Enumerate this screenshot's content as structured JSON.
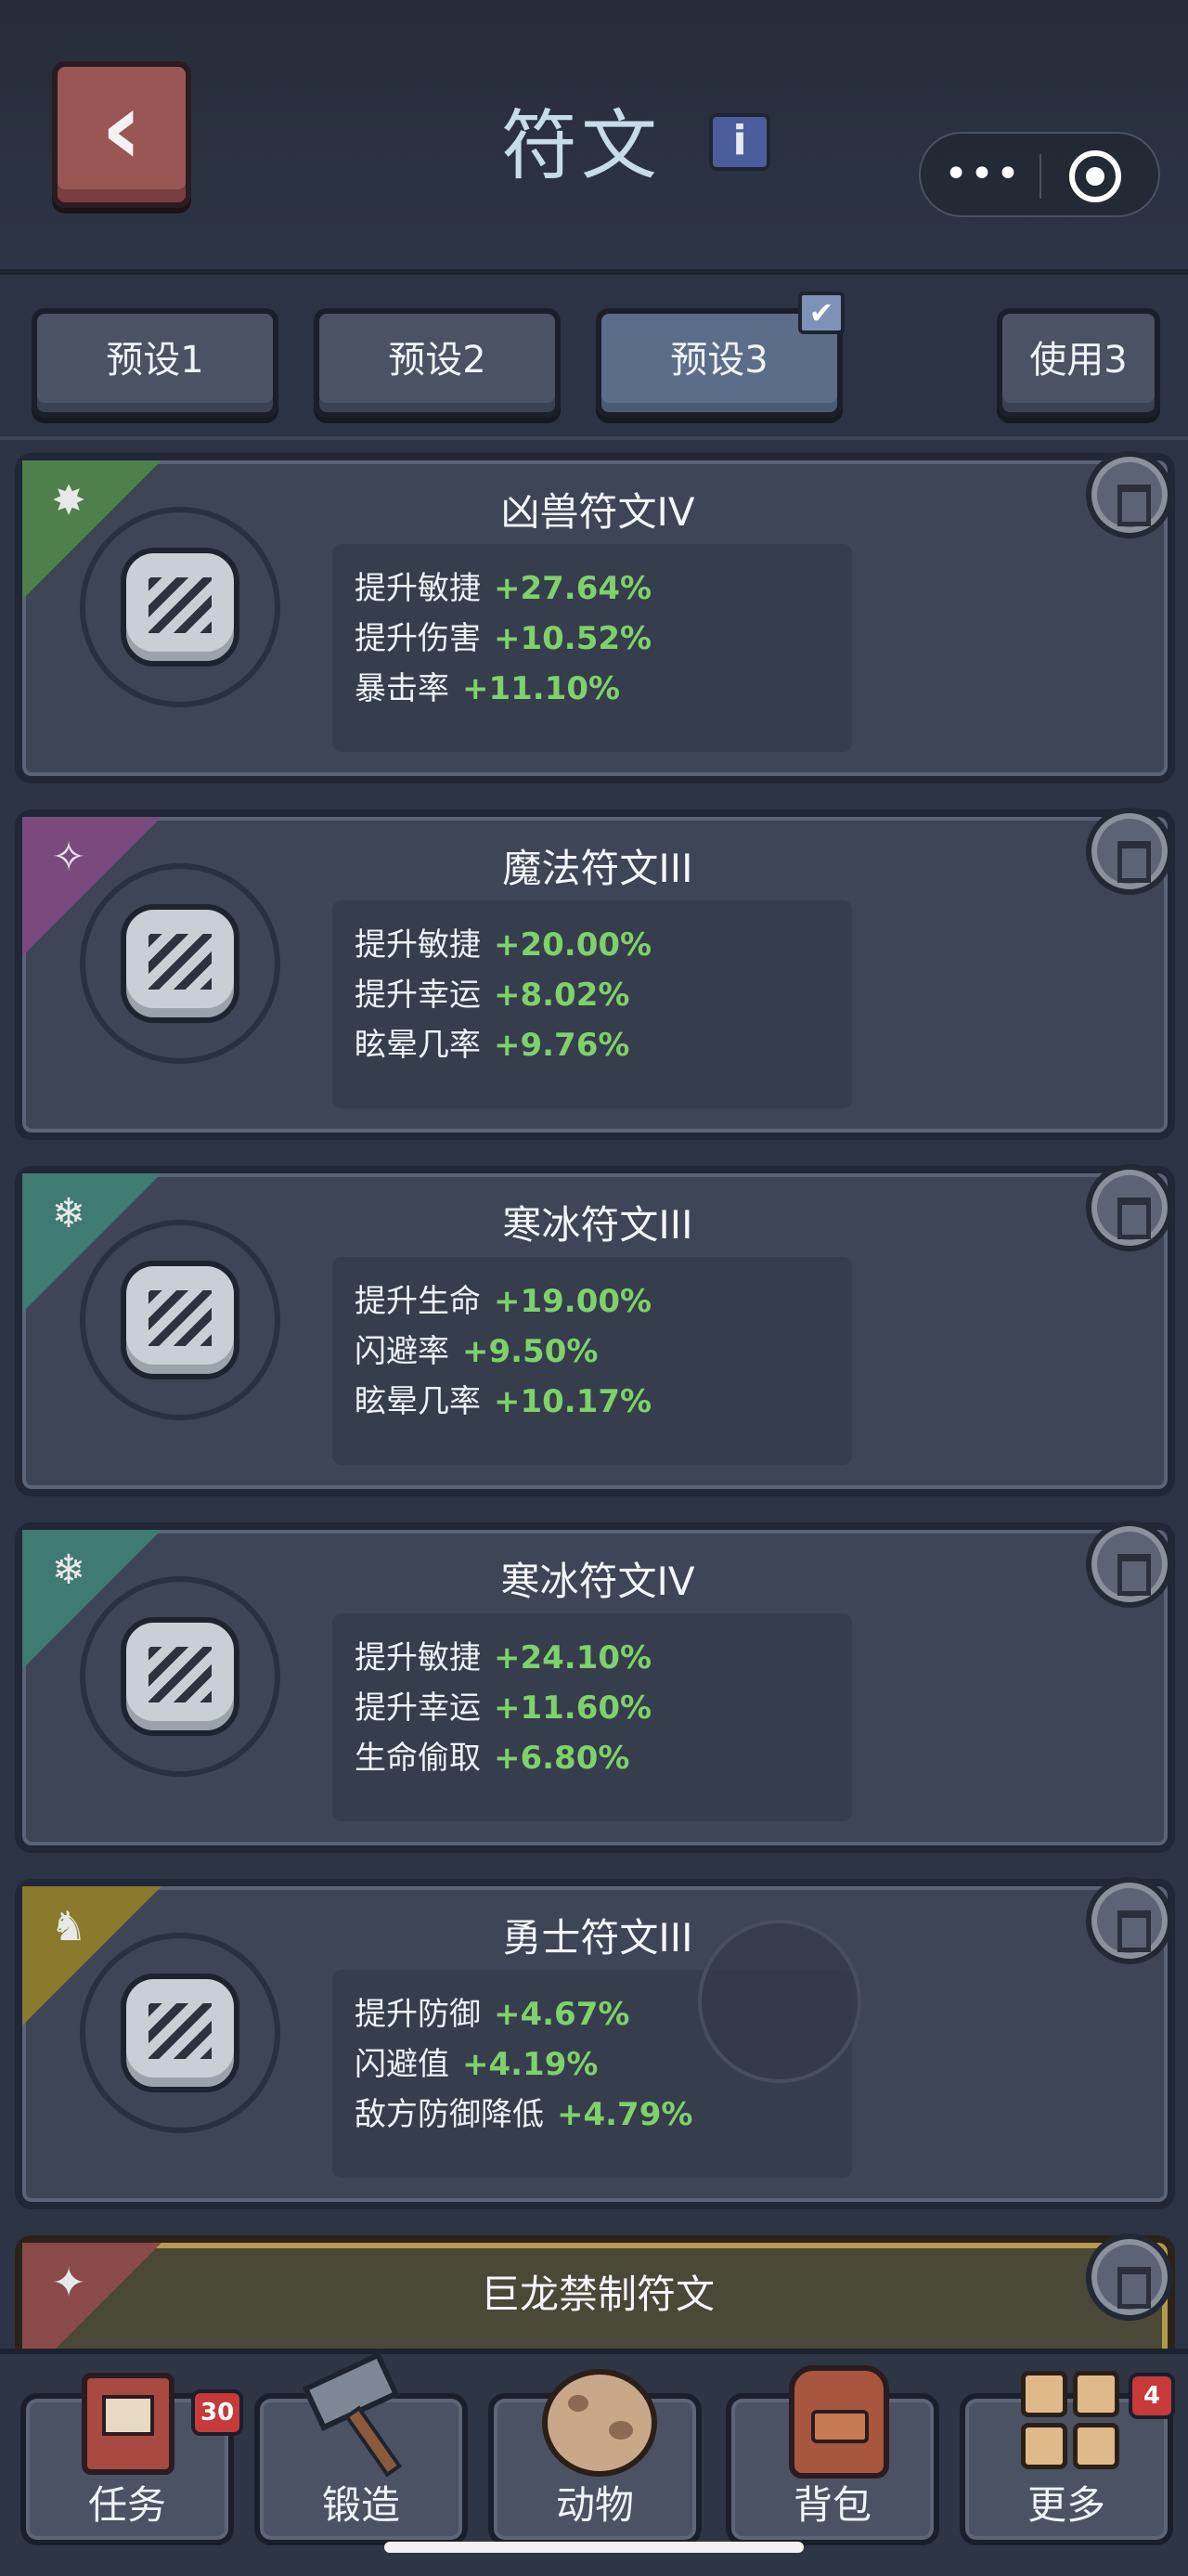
{
  "header": {
    "title": "符文",
    "back_glyph": "‹",
    "info_glyph": "i",
    "more_glyph": "•••"
  },
  "presets": [
    {
      "label": "预设1"
    },
    {
      "label": "预设2"
    },
    {
      "label": "预设3",
      "selected": true
    },
    {
      "label": "使用3"
    }
  ],
  "check_glyph": "✔",
  "runes": [
    {
      "name": "凶兽符文IV",
      "color": "#4f7f4a",
      "icon": "beast-skull-icon",
      "glyph": "✸",
      "stats": [
        {
          "label": "提升敏捷",
          "value": "+27.64%"
        },
        {
          "label": "提升伤害",
          "value": "+10.52%"
        },
        {
          "label": "暴击率",
          "value": "+11.10%"
        }
      ]
    },
    {
      "name": "魔法符文III",
      "color": "#7a4a7e",
      "icon": "magic-wand-icon",
      "glyph": "✧",
      "stats": [
        {
          "label": "提升敏捷",
          "value": "+20.00%"
        },
        {
          "label": "提升幸运",
          "value": "+8.02%"
        },
        {
          "label": "眩晕几率",
          "value": "+9.76%"
        }
      ]
    },
    {
      "name": "寒冰符文III",
      "color": "#3f7a73",
      "icon": "snowflake-icon",
      "glyph": "❄",
      "stats": [
        {
          "label": "提升生命",
          "value": "+19.00%"
        },
        {
          "label": "闪避率",
          "value": "+9.50%"
        },
        {
          "label": "眩晕几率",
          "value": "+10.17%"
        }
      ]
    },
    {
      "name": "寒冰符文IV",
      "color": "#3f7a73",
      "icon": "snowflake-icon",
      "glyph": "❄",
      "stats": [
        {
          "label": "提升敏捷",
          "value": "+24.10%"
        },
        {
          "label": "提升幸运",
          "value": "+11.60%"
        },
        {
          "label": "生命偷取",
          "value": "+6.80%"
        }
      ]
    },
    {
      "name": "勇士符文III",
      "color": "#8a7a2e",
      "icon": "horned-helmet-icon",
      "glyph": "♞",
      "stats": [
        {
          "label": "提升防御",
          "value": "+4.67%"
        },
        {
          "label": "闪避值",
          "value": "+4.19%"
        },
        {
          "label": "敌方防御降低",
          "value": "+4.79%"
        }
      ]
    },
    {
      "name": "巨龙禁制符文",
      "color": "#8a4a4a",
      "icon": "dragon-icon",
      "glyph": "✦",
      "stats": []
    }
  ],
  "nav": [
    {
      "label": "任务",
      "icon": "quest-book-icon",
      "badge": "30"
    },
    {
      "label": "锻造",
      "icon": "hammer-icon",
      "badge": ""
    },
    {
      "label": "动物",
      "icon": "egg-icon",
      "badge": ""
    },
    {
      "label": "背包",
      "icon": "backpack-icon",
      "badge": ""
    },
    {
      "label": "更多",
      "icon": "grid-icon",
      "badge": "4"
    }
  ]
}
